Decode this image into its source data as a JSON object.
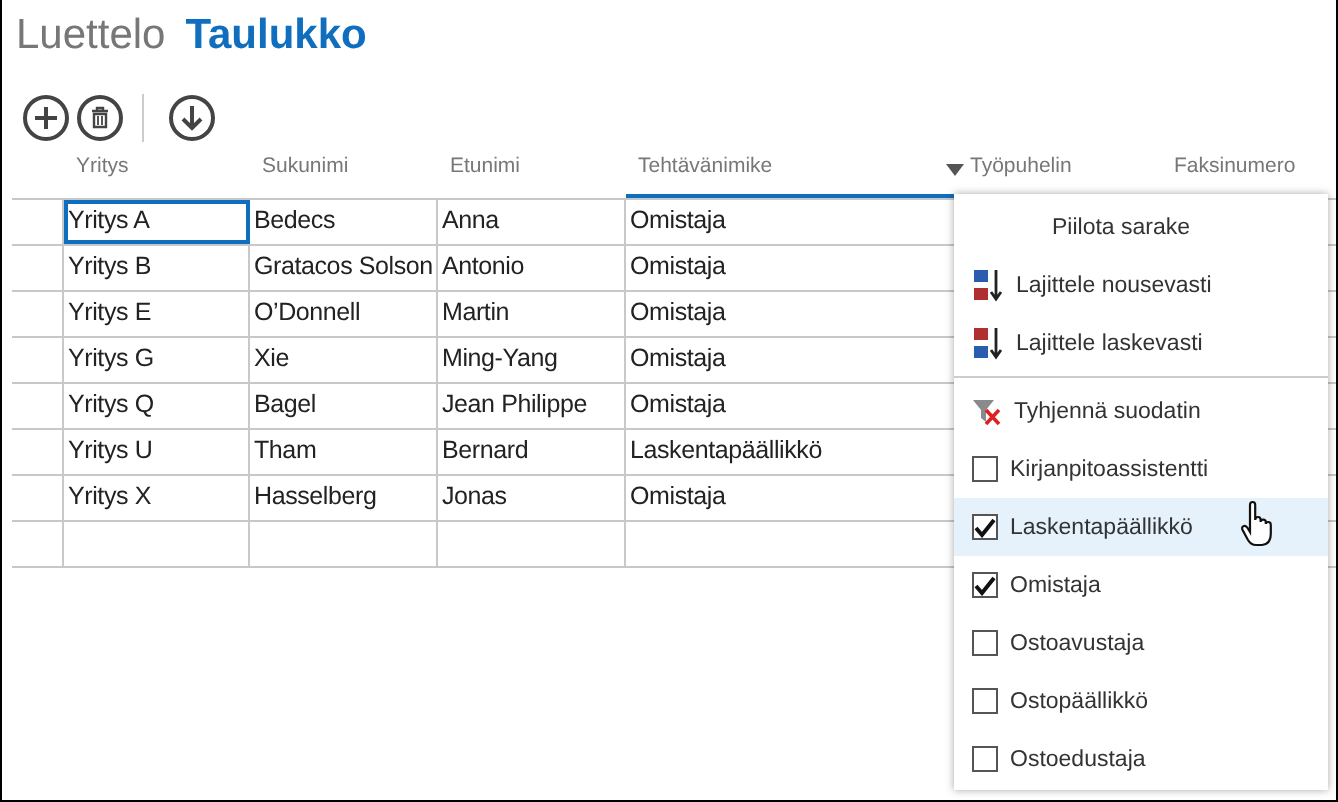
{
  "view_tabs": [
    {
      "label": "Luettelo",
      "selected": false
    },
    {
      "label": "Taulukko",
      "selected": true
    }
  ],
  "table": {
    "columns": [
      {
        "label": "Yritys",
        "menu_open": false
      },
      {
        "label": "Sukunimi",
        "menu_open": false
      },
      {
        "label": "Etunimi",
        "menu_open": false
      },
      {
        "label": "Tehtävänimike",
        "menu_open": true
      },
      {
        "label": "Työpuhelin",
        "menu_open": false
      },
      {
        "label": "Faksinumero",
        "menu_open": false
      }
    ],
    "rows": [
      {
        "cells": [
          {
            "text": "Yritys A",
            "selected": true
          },
          {
            "text": "Bedecs",
            "selected": false
          },
          {
            "text": "Anna",
            "selected": false
          },
          {
            "text": "Omistaja",
            "selected": false
          }
        ]
      },
      {
        "cells": [
          {
            "text": "Yritys B",
            "selected": false
          },
          {
            "text": "Gratacos Solson",
            "selected": false
          },
          {
            "text": "Antonio",
            "selected": false
          },
          {
            "text": "Omistaja",
            "selected": false
          }
        ]
      },
      {
        "cells": [
          {
            "text": "Yritys E",
            "selected": false
          },
          {
            "text": "O’Donnell",
            "selected": false
          },
          {
            "text": "Martin",
            "selected": false
          },
          {
            "text": "Omistaja",
            "selected": false
          }
        ]
      },
      {
        "cells": [
          {
            "text": "Yritys G",
            "selected": false
          },
          {
            "text": "Xie",
            "selected": false
          },
          {
            "text": "Ming-Yang",
            "selected": false
          },
          {
            "text": "Omistaja",
            "selected": false
          }
        ]
      },
      {
        "cells": [
          {
            "text": "Yritys Q",
            "selected": false
          },
          {
            "text": "Bagel",
            "selected": false
          },
          {
            "text": "Jean Philippe",
            "selected": false
          },
          {
            "text": "Omistaja",
            "selected": false
          }
        ]
      },
      {
        "cells": [
          {
            "text": "Yritys U",
            "selected": false
          },
          {
            "text": "Tham",
            "selected": false
          },
          {
            "text": "Bernard",
            "selected": false
          },
          {
            "text": "Laskentapäällikkö",
            "selected": false
          }
        ]
      },
      {
        "cells": [
          {
            "text": "Yritys X",
            "selected": false
          },
          {
            "text": "Hasselberg",
            "selected": false
          },
          {
            "text": "Jonas",
            "selected": false
          },
          {
            "text": "Omistaja",
            "selected": false
          }
        ]
      }
    ]
  },
  "column_menu": {
    "items": [
      {
        "kind": "action",
        "label": "Piilota sarake"
      },
      {
        "kind": "sort_ascending",
        "label": "Lajittele nousevasti"
      },
      {
        "kind": "sort_descending",
        "label": "Lajittele laskevasti"
      },
      {
        "kind": "separator"
      },
      {
        "kind": "clear_filter",
        "label": "Tyhjennä suodatin"
      },
      {
        "kind": "option",
        "label": "Kirjanpitoassistentti",
        "checked": false,
        "hovered": false
      },
      {
        "kind": "option",
        "label": "Laskentapäällikkö",
        "checked": true,
        "hovered": true
      },
      {
        "kind": "option",
        "label": "Omistaja",
        "checked": true,
        "hovered": false
      },
      {
        "kind": "option",
        "label": "Ostoavustaja",
        "checked": false,
        "hovered": false
      },
      {
        "kind": "option",
        "label": "Ostopäällikkö",
        "checked": false,
        "hovered": false
      },
      {
        "kind": "option",
        "label": "Ostoedustaja",
        "checked": false,
        "hovered": false
      }
    ]
  }
}
